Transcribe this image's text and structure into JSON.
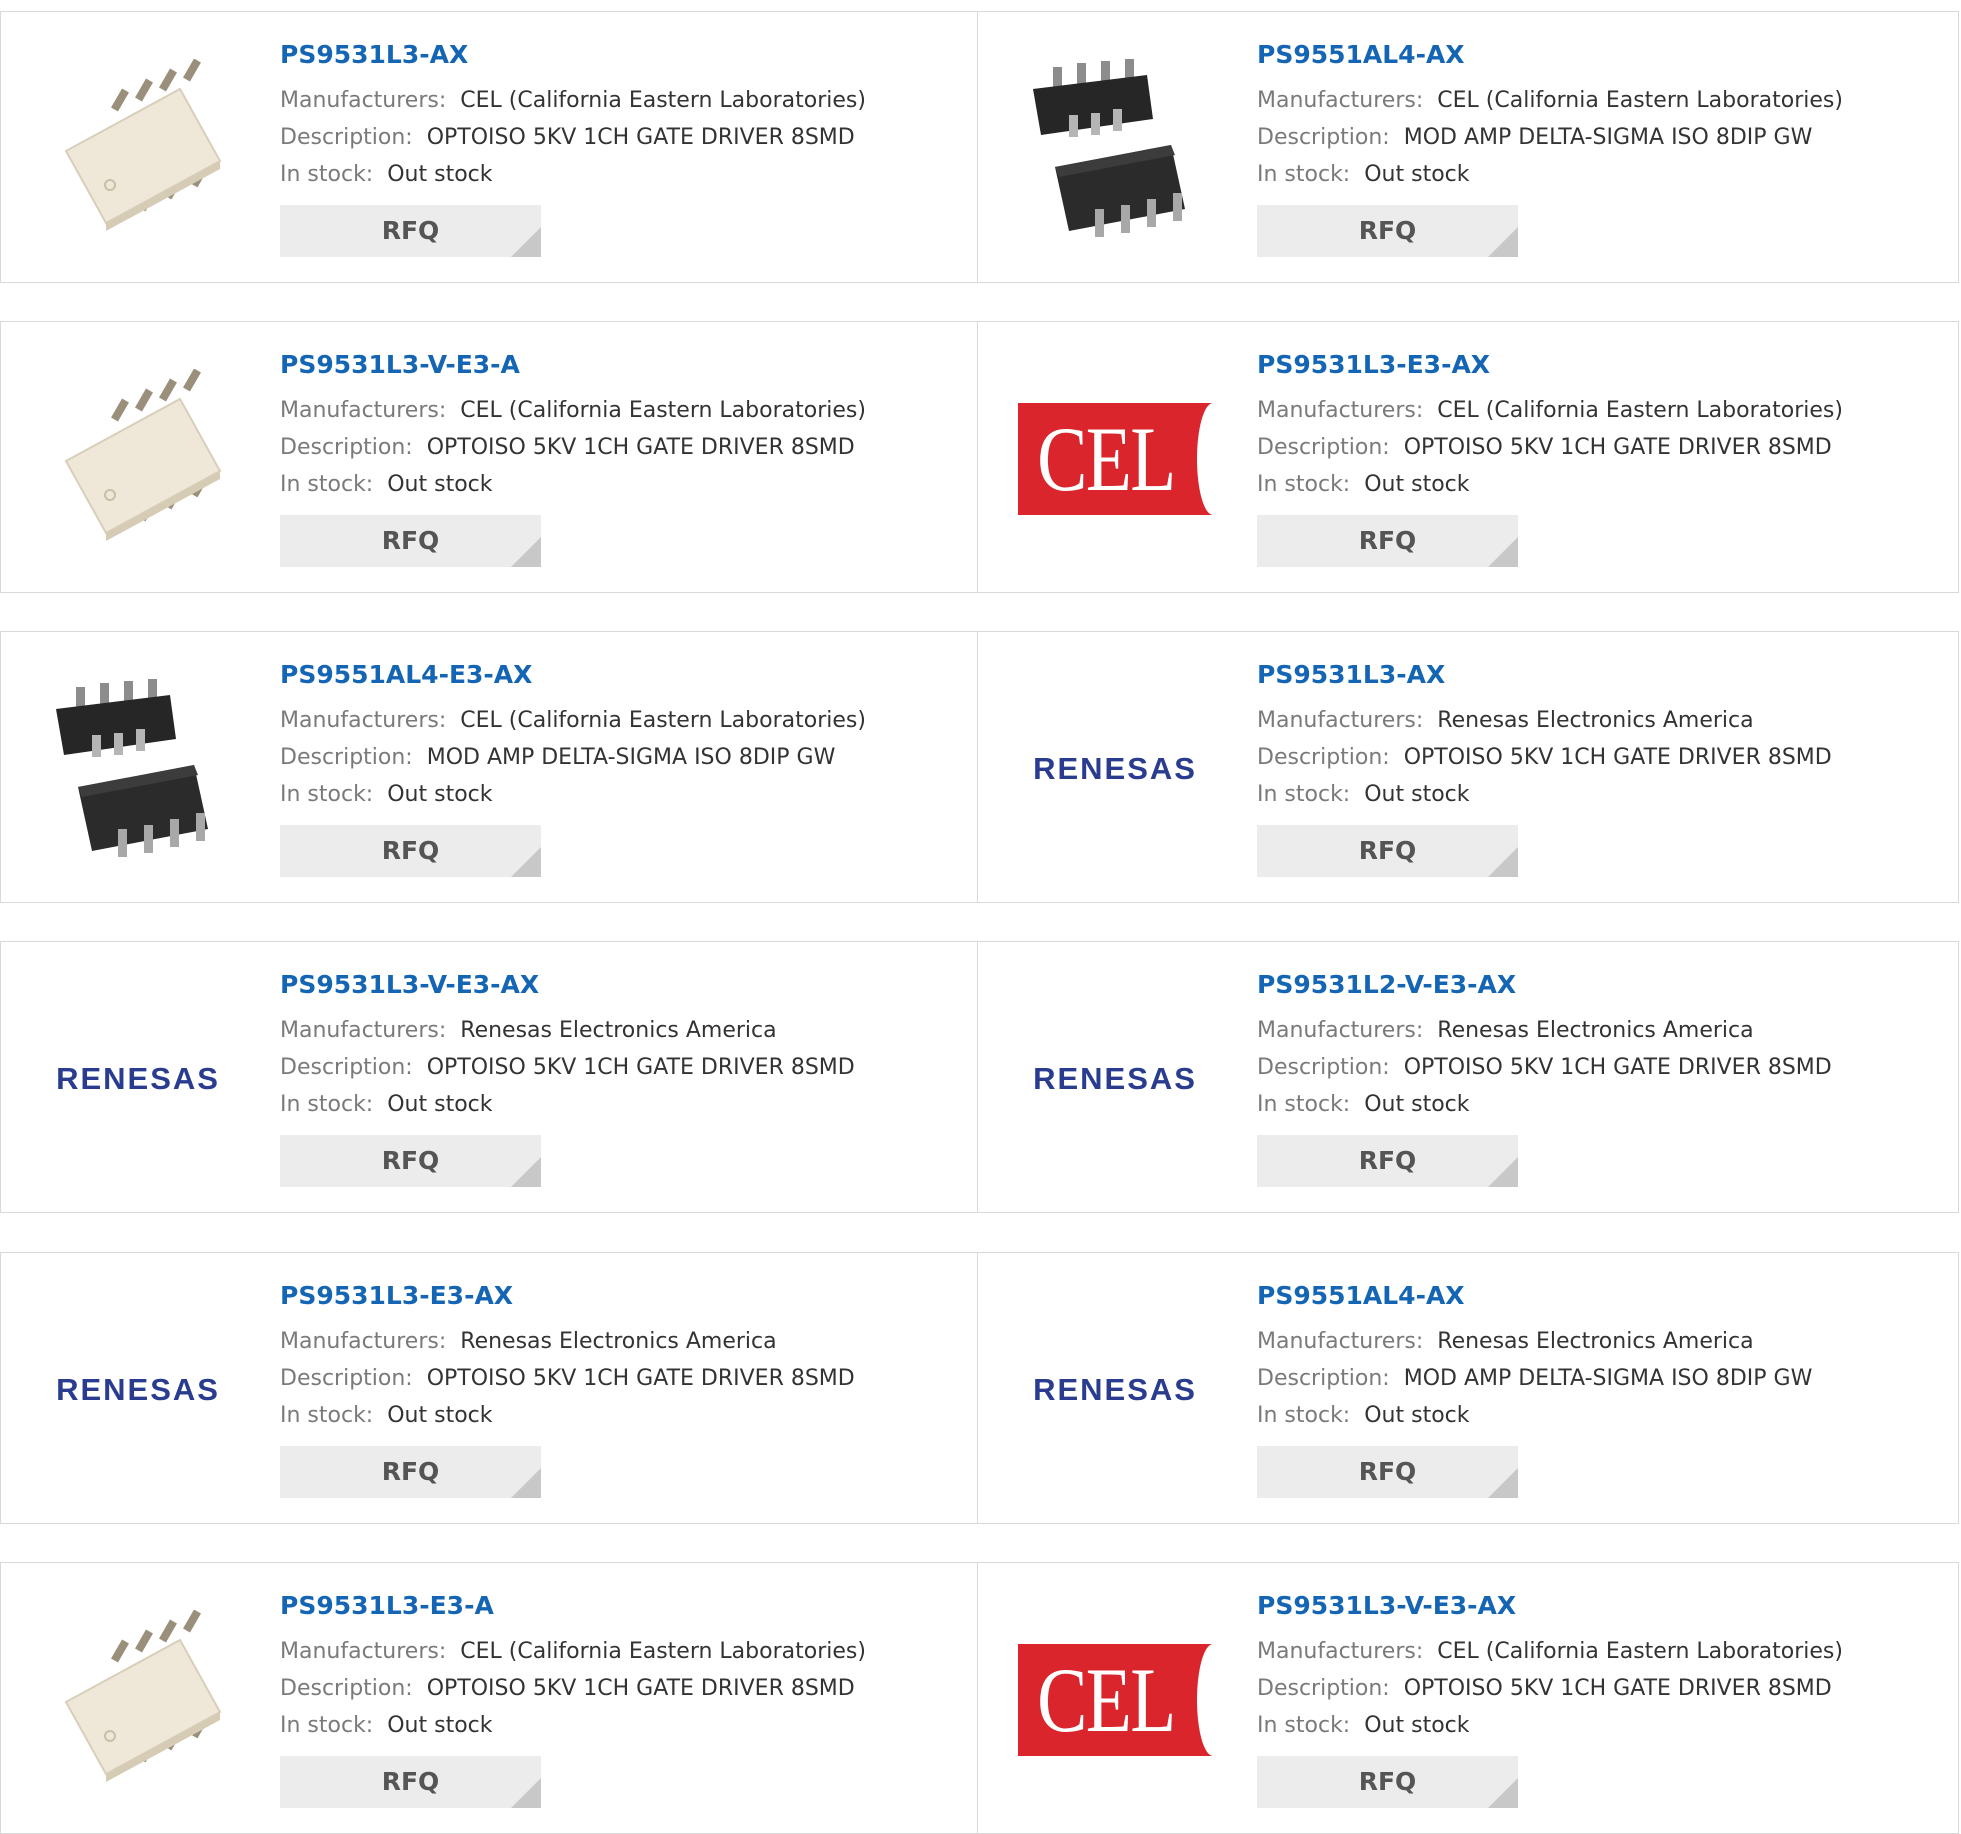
{
  "labels": {
    "manufacturers": "Manufacturers:",
    "description": "Description:",
    "in_stock": "In stock:",
    "rfq": "RFQ"
  },
  "colors": {
    "link": "#1565b5",
    "cel_red": "#d9252b",
    "renesas_blue": "#2a3c8f"
  },
  "logos": {
    "cel": "CEL",
    "renesas": "RENESAS"
  },
  "products": [
    {
      "part": "PS9531L3-AX",
      "manufacturer": "CEL (California Eastern Laboratories)",
      "description": "OPTOISO 5KV 1CH GATE DRIVER 8SMD",
      "stock": "Out stock",
      "image": "white-smd-chip"
    },
    {
      "part": "PS9551AL4-AX",
      "manufacturer": "CEL (California Eastern Laboratories)",
      "description": "MOD AMP DELTA-SIGMA ISO 8DIP GW",
      "stock": "Out stock",
      "image": "black-dip-chips"
    },
    {
      "part": "PS9531L3-V-E3-A",
      "manufacturer": "CEL (California Eastern Laboratories)",
      "description": "OPTOISO 5KV 1CH GATE DRIVER 8SMD",
      "stock": "Out stock",
      "image": "white-smd-chip"
    },
    {
      "part": "PS9531L3-E3-AX",
      "manufacturer": "CEL (California Eastern Laboratories)",
      "description": "OPTOISO 5KV 1CH GATE DRIVER 8SMD",
      "stock": "Out stock",
      "image": "cel-logo"
    },
    {
      "part": "PS9551AL4-E3-AX",
      "manufacturer": "CEL (California Eastern Laboratories)",
      "description": "MOD AMP DELTA-SIGMA ISO 8DIP GW",
      "stock": "Out stock",
      "image": "black-dip-chips"
    },
    {
      "part": "PS9531L3-AX",
      "manufacturer": "Renesas Electronics America",
      "description": "OPTOISO 5KV 1CH GATE DRIVER 8SMD",
      "stock": "Out stock",
      "image": "renesas-logo"
    },
    {
      "part": "PS9531L3-V-E3-AX",
      "manufacturer": "Renesas Electronics America",
      "description": "OPTOISO 5KV 1CH GATE DRIVER 8SMD",
      "stock": "Out stock",
      "image": "renesas-logo"
    },
    {
      "part": "PS9531L2-V-E3-AX",
      "manufacturer": "Renesas Electronics America",
      "description": "OPTOISO 5KV 1CH GATE DRIVER 8SMD",
      "stock": "Out stock",
      "image": "renesas-logo"
    },
    {
      "part": "PS9531L3-E3-AX",
      "manufacturer": "Renesas Electronics America",
      "description": "OPTOISO 5KV 1CH GATE DRIVER 8SMD",
      "stock": "Out stock",
      "image": "renesas-logo"
    },
    {
      "part": "PS9551AL4-AX",
      "manufacturer": "Renesas Electronics America",
      "description": "MOD AMP DELTA-SIGMA ISO 8DIP GW",
      "stock": "Out stock",
      "image": "renesas-logo"
    },
    {
      "part": "PS9531L3-E3-A",
      "manufacturer": "CEL (California Eastern Laboratories)",
      "description": "OPTOISO 5KV 1CH GATE DRIVER 8SMD",
      "stock": "Out stock",
      "image": "white-smd-chip"
    },
    {
      "part": "PS9531L3-V-E3-AX",
      "manufacturer": "CEL (California Eastern Laboratories)",
      "description": "OPTOISO 5KV 1CH GATE DRIVER 8SMD",
      "stock": "Out stock",
      "image": "cel-logo"
    }
  ]
}
